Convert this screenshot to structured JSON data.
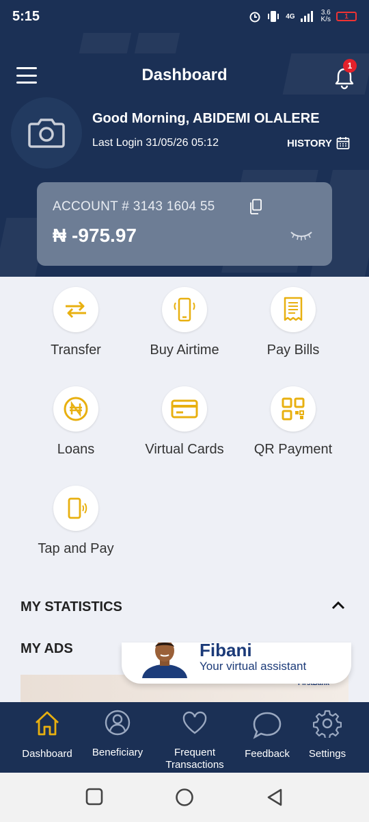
{
  "status_bar": {
    "time": "5:15",
    "network": "4G",
    "speed": "3.6",
    "speed_unit": "K/s",
    "battery": "1"
  },
  "header": {
    "title": "Dashboard",
    "notification_count": "1",
    "greeting": "Good Morning, ABIDEMI OLALERE",
    "last_login": "Last Login 31/05/26 05:12",
    "history_label": "HISTORY"
  },
  "account": {
    "label": "ACCOUNT # 3143 1604 55",
    "balance": "₦ -975.97"
  },
  "actions": [
    {
      "label": "Transfer",
      "icon": "transfer-icon"
    },
    {
      "label": "Buy Airtime",
      "icon": "phone-icon"
    },
    {
      "label": "Pay Bills",
      "icon": "receipt-icon"
    },
    {
      "label": "Loans",
      "icon": "naira-icon"
    },
    {
      "label": "Virtual Cards",
      "icon": "card-icon"
    },
    {
      "label": "QR Payment",
      "icon": "qr-icon"
    },
    {
      "label": "Tap and Pay",
      "icon": "tap-phone-icon"
    }
  ],
  "sections": {
    "statistics": "MY STATISTICS",
    "ads": "MY ADS"
  },
  "assistant": {
    "name": "Fibani",
    "tagline": "Your virtual assistant"
  },
  "ad_brand": "FirstBank",
  "bottom_nav": [
    {
      "label": "Dashboard",
      "icon": "home-icon",
      "active": true
    },
    {
      "label": "Beneficiary",
      "icon": "person-icon"
    },
    {
      "label": "Frequent",
      "label2": "Transactions",
      "icon": "heart-icon"
    },
    {
      "label": "Feedback",
      "icon": "chat-icon"
    },
    {
      "label": "Settings",
      "icon": "gear-icon"
    }
  ],
  "colors": {
    "brand": "#1b3055",
    "accent": "#e8b010",
    "badge": "#e3212b"
  }
}
